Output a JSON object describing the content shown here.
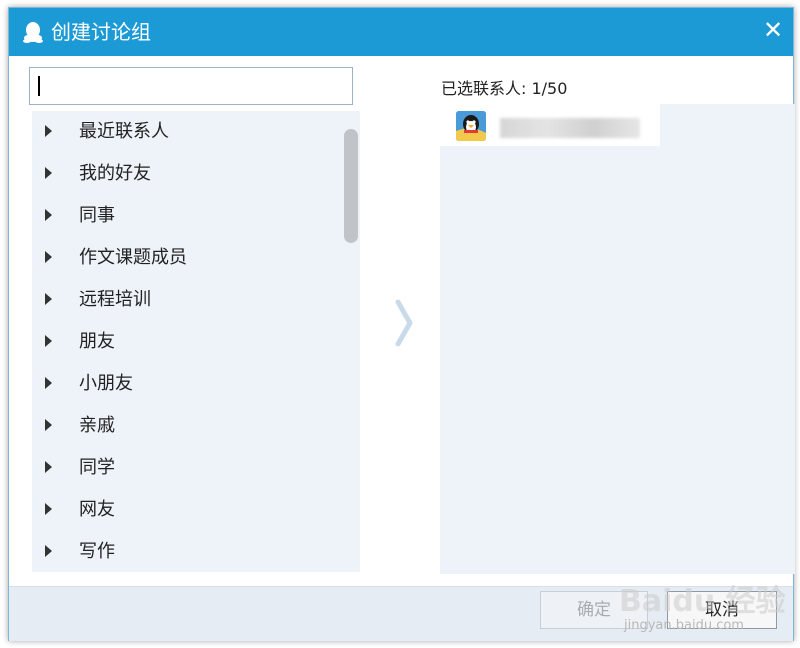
{
  "window": {
    "title": "创建讨论组",
    "close_glyph": "✕"
  },
  "search": {
    "value": "",
    "placeholder": ""
  },
  "groups": [
    {
      "label": "最近联系人"
    },
    {
      "label": "我的好友"
    },
    {
      "label": "同事"
    },
    {
      "label": "作文课题成员"
    },
    {
      "label": "远程培训"
    },
    {
      "label": "朋友"
    },
    {
      "label": "小朋友"
    },
    {
      "label": "亲戚"
    },
    {
      "label": "同学"
    },
    {
      "label": "网友"
    },
    {
      "label": "写作"
    }
  ],
  "selected": {
    "header": "已选联系人: 1/50",
    "contacts": [
      {
        "avatar_icon": "qq-penguin-avatar"
      }
    ]
  },
  "buttons": {
    "ok": "确定",
    "cancel": "取消"
  },
  "watermark": {
    "text": "Baidu 经验",
    "url_text": "jingyan.baidu.com"
  },
  "colors": {
    "titlebar": "#1c9ad6",
    "panel_bg": "#eef3fa",
    "footer_bg": "#e6ecf4"
  }
}
